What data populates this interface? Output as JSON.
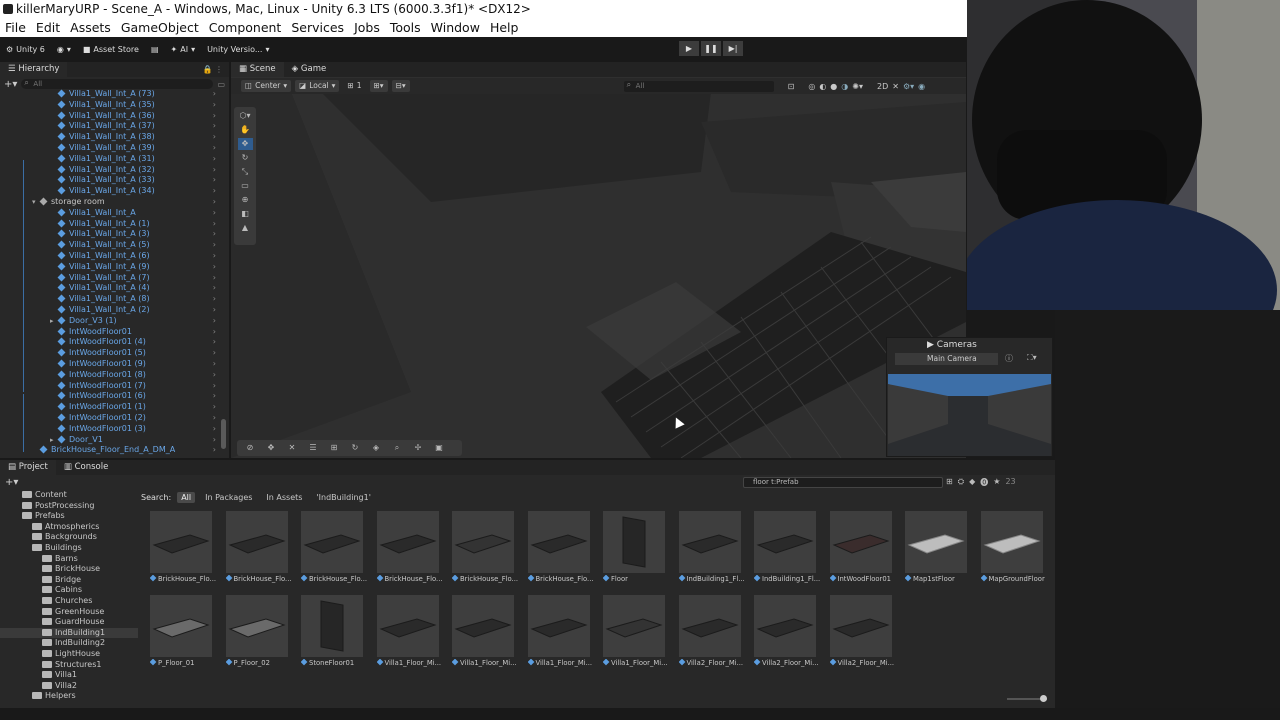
{
  "window": {
    "title": "killerMaryURP - Scene_A - Windows, Mac, Linux - Unity 6.3 LTS (6000.3.3f1)* <DX12>"
  },
  "menu": [
    "File",
    "Edit",
    "Assets",
    "GameObject",
    "Component",
    "Services",
    "Jobs",
    "Tools",
    "Window",
    "Help"
  ],
  "toolbar": {
    "account": "Unity 6",
    "asset_store": "Asset Store",
    "ai": "AI",
    "version_control": "Unity Versio..."
  },
  "hierarchy": {
    "tab": "Hierarchy",
    "search_placeholder": "All",
    "items": [
      {
        "label": "Villa1_Wall_Int_A (73)",
        "indent": 3
      },
      {
        "label": "Villa1_Wall_Int_A (35)",
        "indent": 3
      },
      {
        "label": "Villa1_Wall_Int_A (36)",
        "indent": 3
      },
      {
        "label": "Villa1_Wall_Int_A (37)",
        "indent": 3
      },
      {
        "label": "Villa1_Wall_Int_A (38)",
        "indent": 3
      },
      {
        "label": "Villa1_Wall_Int_A (39)",
        "indent": 3
      },
      {
        "label": "Villa1_Wall_Int_A (31)",
        "indent": 3
      },
      {
        "label": "Villa1_Wall_Int_A (32)",
        "indent": 3
      },
      {
        "label": "Villa1_Wall_Int_A (33)",
        "indent": 3
      },
      {
        "label": "Villa1_Wall_Int_A (34)",
        "indent": 3
      },
      {
        "label": "storage room",
        "indent": 2,
        "group": true
      },
      {
        "label": "Villa1_Wall_Int_A",
        "indent": 3
      },
      {
        "label": "Villa1_Wall_Int_A (1)",
        "indent": 3
      },
      {
        "label": "Villa1_Wall_Int_A (3)",
        "indent": 3
      },
      {
        "label": "Villa1_Wall_Int_A (5)",
        "indent": 3
      },
      {
        "label": "Villa1_Wall_Int_A (6)",
        "indent": 3
      },
      {
        "label": "Villa1_Wall_Int_A (9)",
        "indent": 3
      },
      {
        "label": "Villa1_Wall_Int_A (7)",
        "indent": 3
      },
      {
        "label": "Villa1_Wall_Int_A (4)",
        "indent": 3
      },
      {
        "label": "Villa1_Wall_Int_A (8)",
        "indent": 3
      },
      {
        "label": "Villa1_Wall_Int_A (2)",
        "indent": 3
      },
      {
        "label": "Door_V3 (1)",
        "indent": 3,
        "expandable": true
      },
      {
        "label": "IntWoodFloor01",
        "indent": 3
      },
      {
        "label": "IntWoodFloor01 (4)",
        "indent": 3
      },
      {
        "label": "IntWoodFloor01 (5)",
        "indent": 3
      },
      {
        "label": "IntWoodFloor01 (9)",
        "indent": 3
      },
      {
        "label": "IntWoodFloor01 (8)",
        "indent": 3
      },
      {
        "label": "IntWoodFloor01 (7)",
        "indent": 3
      },
      {
        "label": "IntWoodFloor01 (6)",
        "indent": 3
      },
      {
        "label": "IntWoodFloor01 (1)",
        "indent": 3
      },
      {
        "label": "IntWoodFloor01 (2)",
        "indent": 3
      },
      {
        "label": "IntWoodFloor01 (3)",
        "indent": 3
      },
      {
        "label": "Door_V1",
        "indent": 3,
        "expandable": true
      },
      {
        "label": "BrickHouse_Floor_End_A_DM_A",
        "indent": 2
      }
    ]
  },
  "scene": {
    "tabs": [
      "Scene",
      "Game"
    ],
    "pivot": "Center",
    "space": "Local",
    "snap": "1",
    "search_placeholder": "All"
  },
  "cameras": {
    "title": "Cameras",
    "selected": "Main Camera"
  },
  "project": {
    "tabs": [
      "Project",
      "Console"
    ],
    "search_value": "floor t:Prefab",
    "count": "23",
    "search_label": "Search:",
    "scopes": [
      "All",
      "In Packages",
      "In Assets",
      "'IndBuilding1'"
    ],
    "tree": [
      {
        "label": "Content",
        "indent": 1
      },
      {
        "label": "PostProcessing",
        "indent": 1
      },
      {
        "label": "Prefabs",
        "indent": 1
      },
      {
        "label": "Atmospherics",
        "indent": 2
      },
      {
        "label": "Backgrounds",
        "indent": 2
      },
      {
        "label": "Buildings",
        "indent": 2
      },
      {
        "label": "Barns",
        "indent": 3
      },
      {
        "label": "BrickHouse",
        "indent": 3
      },
      {
        "label": "Bridge",
        "indent": 3
      },
      {
        "label": "Cabins",
        "indent": 3
      },
      {
        "label": "Churches",
        "indent": 3
      },
      {
        "label": "GreenHouse",
        "indent": 3
      },
      {
        "label": "GuardHouse",
        "indent": 3
      },
      {
        "label": "IndBuilding1",
        "indent": 3,
        "selected": true
      },
      {
        "label": "IndBuilding2",
        "indent": 3
      },
      {
        "label": "LightHouse",
        "indent": 3
      },
      {
        "label": "Structures1",
        "indent": 3
      },
      {
        "label": "Villa1",
        "indent": 3
      },
      {
        "label": "Villa2",
        "indent": 3
      },
      {
        "label": "Helpers",
        "indent": 2
      }
    ],
    "assets": [
      {
        "label": "BrickHouse_Flo...",
        "shade": "#2a2a2a",
        "tone": "dark"
      },
      {
        "label": "BrickHouse_Flo...",
        "shade": "#2a2a2a",
        "tone": "dark"
      },
      {
        "label": "BrickHouse_Flo...",
        "shade": "#2a2a2a",
        "tone": "dark"
      },
      {
        "label": "BrickHouse_Flo...",
        "shade": "#2a2a2a",
        "tone": "dark"
      },
      {
        "label": "BrickHouse_Flo...",
        "shade": "#333333",
        "tone": "dark"
      },
      {
        "label": "BrickHouse_Flo...",
        "shade": "#2a2a2a",
        "tone": "dark"
      },
      {
        "label": "Floor",
        "shade": "#262626",
        "tone": "wall"
      },
      {
        "label": "IndBuilding1_Fl...",
        "shade": "#2a2a2a",
        "tone": "dark"
      },
      {
        "label": "IndBuilding1_Fl...",
        "shade": "#2a2a2a",
        "tone": "dark"
      },
      {
        "label": "IntWoodFloor01",
        "shade": "#3a2c2c",
        "tone": "dark"
      },
      {
        "label": "Map1stFloor",
        "shade": "#bdbdbd",
        "tone": "light"
      },
      {
        "label": "MapGroundFloor",
        "shade": "#bdbdbd",
        "tone": "light"
      },
      {
        "label": "P_Floor_01",
        "shade": "#6a6a6a",
        "tone": "mid"
      },
      {
        "label": "P_Floor_02",
        "shade": "#6a6a6a",
        "tone": "mid"
      },
      {
        "label": "StoneFloor01",
        "shade": "#262626",
        "tone": "wall"
      },
      {
        "label": "Villa1_Floor_Mi...",
        "shade": "#2a2a2a",
        "tone": "dark"
      },
      {
        "label": "Villa1_Floor_Mi...",
        "shade": "#2a2a2a",
        "tone": "dark"
      },
      {
        "label": "Villa1_Floor_Mi...",
        "shade": "#2a2a2a",
        "tone": "dark"
      },
      {
        "label": "Villa1_Floor_Mi...",
        "shade": "#333333",
        "tone": "dark"
      },
      {
        "label": "Villa2_Floor_Mi...",
        "shade": "#2a2a2a",
        "tone": "dark"
      },
      {
        "label": "Villa2_Floor_Mi...",
        "shade": "#2a2a2a",
        "tone": "dark"
      },
      {
        "label": "Villa2_Floor_Mi...",
        "shade": "#2a2a2a",
        "tone": "dark"
      }
    ]
  },
  "colors": {
    "accent": "#2f5c8f",
    "prefab_blue": "#5b9de0",
    "panel": "#282828"
  }
}
